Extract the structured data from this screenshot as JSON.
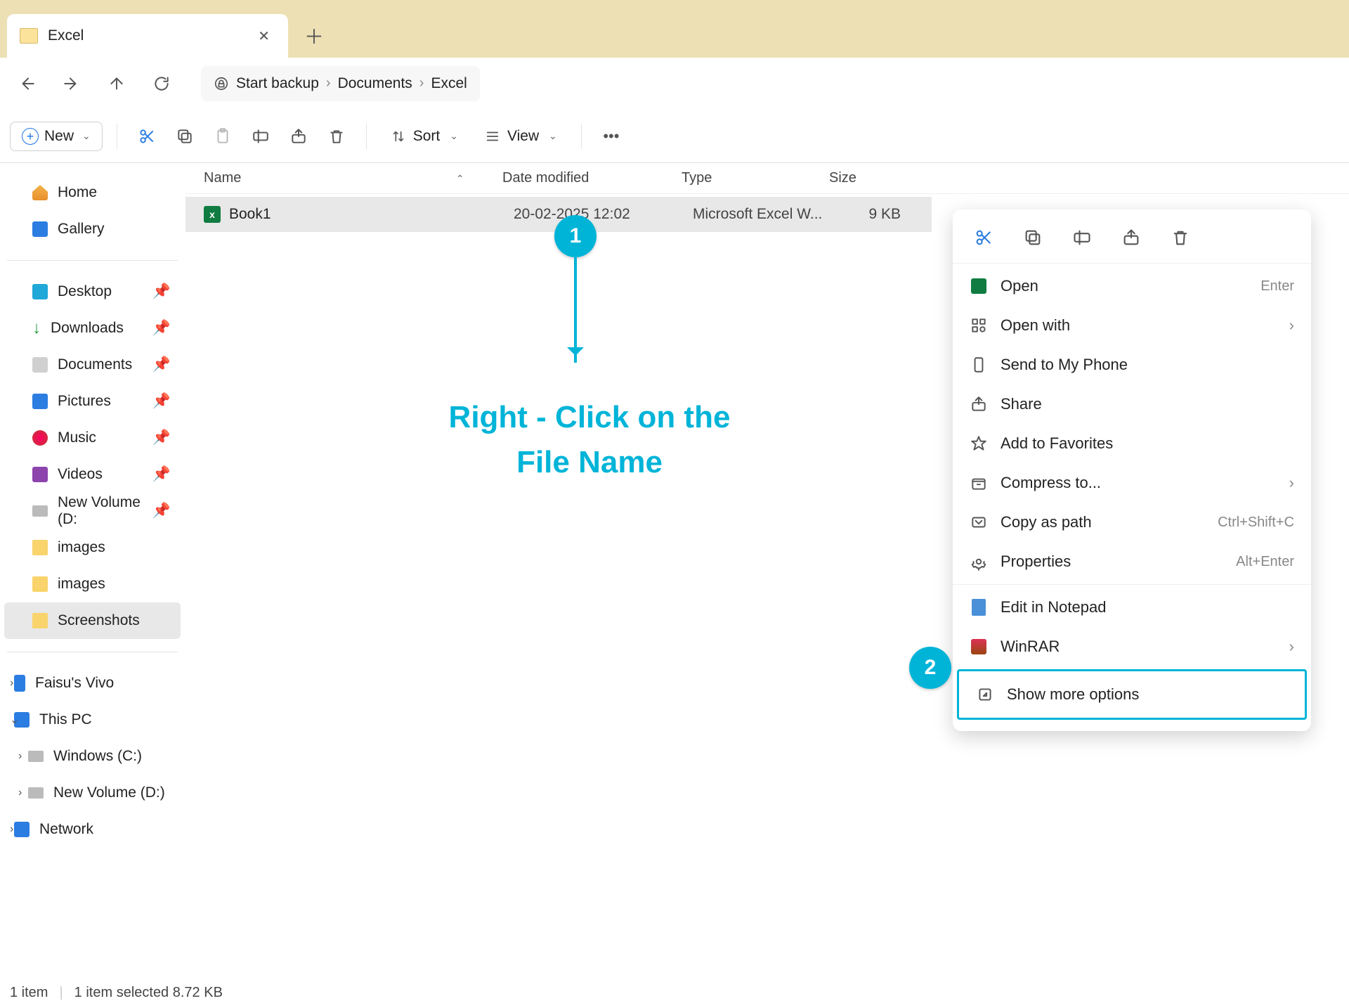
{
  "tab": {
    "title": "Excel"
  },
  "breadcrumb": {
    "root": "Start backup",
    "mid": "Documents",
    "leaf": "Excel"
  },
  "toolbar": {
    "new": "New",
    "sort": "Sort",
    "view": "View"
  },
  "columns": {
    "name": "Name",
    "date": "Date modified",
    "type": "Type",
    "size": "Size"
  },
  "file": {
    "name": "Book1",
    "date": "20-02-2025 12:02",
    "type": "Microsoft Excel W...",
    "size": "9 KB"
  },
  "sidebar": {
    "home": "Home",
    "gallery": "Gallery",
    "desktop": "Desktop",
    "downloads": "Downloads",
    "documents": "Documents",
    "pictures": "Pictures",
    "music": "Music",
    "videos": "Videos",
    "newvol": "New Volume (D:",
    "images1": "images",
    "images2": "images",
    "screenshots": "Screenshots",
    "phone": "Faisu's Vivo",
    "thispc": "This PC",
    "windows": "Windows (C:)",
    "newvol2": "New Volume (D:)",
    "network": "Network"
  },
  "ctx": {
    "open": "Open",
    "open_hint": "Enter",
    "openwith": "Open with",
    "sendphone": "Send to My Phone",
    "share": "Share",
    "fav": "Add to Favorites",
    "compress": "Compress to...",
    "copypath": "Copy as path",
    "copypath_hint": "Ctrl+Shift+C",
    "properties": "Properties",
    "properties_hint": "Alt+Enter",
    "notepad": "Edit in Notepad",
    "winrar": "WinRAR",
    "more": "Show more options"
  },
  "annot": {
    "one": "1",
    "two": "2",
    "text1": "Right - Click on the",
    "text2": "File Name"
  },
  "status": {
    "count": "1 item",
    "sel": "1 item selected  8.72 KB"
  }
}
